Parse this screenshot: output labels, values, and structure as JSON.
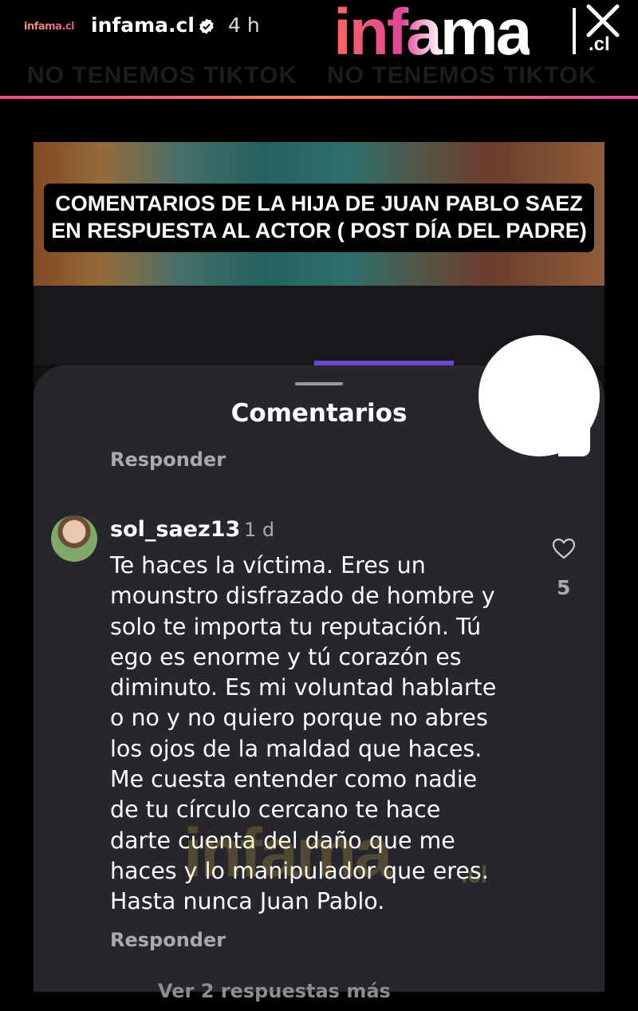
{
  "story": {
    "mini_logo": "infama.cl",
    "username": "infama.cl",
    "time": "4 h",
    "verified_icon": "verified-check-icon"
  },
  "brand": {
    "logo_text": "infama",
    "logo_suffix": ".cl",
    "banner": [
      "NO TENEMOS TIKTOK",
      "NO TENEMOS TIKTOK"
    ]
  },
  "headline": {
    "line1": "COMENTARIOS DE LA HIJA DE JUAN PABLO SAEZ",
    "line2": "EN RESPUESTA AL ACTOR ( POST DÍA DEL PADRE)"
  },
  "comments_sheet": {
    "title": "Comentarios",
    "reply_top": "Responder",
    "comment": {
      "username": "sol_saez13",
      "time": "1 d",
      "lines": [
        "Te haces la víctima. Eres un",
        "mounstro disfrazado de hombre y",
        "solo te importa tu reputación. Tú",
        "ego es enorme y tú corazón es",
        "diminuto. Es mi voluntad hablarte",
        "o no y no quiero porque no abres",
        "los ojos de la maldad que haces.",
        "Me cuesta entender como nadie",
        "de tu círculo cercano te hace",
        "darte cuenta del daño que me",
        "haces y lo manipulador que eres.",
        "Hasta nunca Juan Pablo."
      ],
      "likes": "5",
      "reply": "Responder"
    },
    "more_replies": "Ver 2 respuestas más"
  },
  "sticker": {
    "emoji": "😱"
  },
  "colors": {
    "gradient_pink": "#e2449a",
    "gradient_orange": "#f26a5e",
    "sheet_bg": "#26262c",
    "muted_text": "#a9a9b0"
  }
}
